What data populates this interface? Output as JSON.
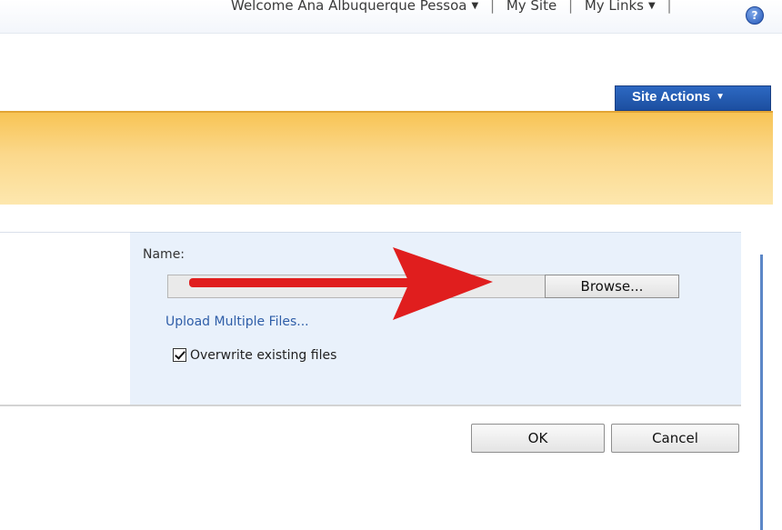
{
  "topbar": {
    "welcome": "Welcome Ana Albuquerque Pessoa",
    "my_site": "My Site",
    "my_links": "My Links",
    "help_glyph": "?",
    "separator": "|",
    "caret": "▼"
  },
  "site_actions": {
    "label": "Site Actions",
    "caret": "▼"
  },
  "form": {
    "name_label": "Name:",
    "file_value": "",
    "browse_label": "Browse...",
    "upload_multiple_label": "Upload Multiple Files...",
    "overwrite_label": "Overwrite existing files",
    "overwrite_checked": true
  },
  "buttons": {
    "ok": "OK",
    "cancel": "Cancel"
  },
  "colors": {
    "accent_blue": "#1c4fa0",
    "band_orange": "#f8c455",
    "form_bg": "#e9f1fb",
    "annotation_red": "#e01e1e"
  },
  "icons": [
    "help-icon",
    "dropdown-caret-icon",
    "checkbox-checked-icon",
    "red-arrow-annotation"
  ]
}
